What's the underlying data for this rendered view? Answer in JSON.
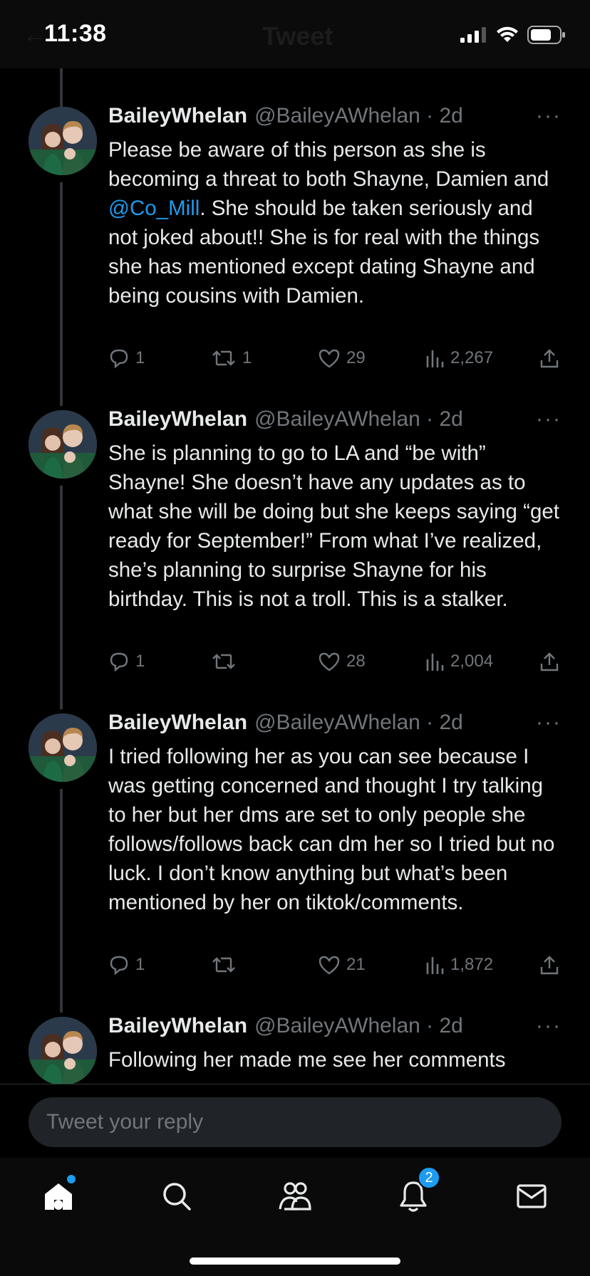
{
  "status_bar": {
    "time": "11:38",
    "ghost_title": "Tweet"
  },
  "thread": [
    {
      "name": "BaileyWhelan",
      "handle": "@BaileyAWhelan · 2d",
      "text_before": "Please be aware of this person as she is becoming a threat to both Shayne, Damien and ",
      "mention": "@Co_Mill",
      "text_after": ". She should be taken seriously and not joked about!! She is for real with the things she has mentioned except dating Shayne and being cousins with Damien.",
      "replies": "1",
      "retweets": "1",
      "likes": "29",
      "views": "2,267"
    },
    {
      "name": "BaileyWhelan",
      "handle": "@BaileyAWhelan · 2d",
      "text": "She is planning to go to LA and “be with” Shayne! She doesn’t have any updates as to what she will be doing but she keeps saying “get ready for September!” From what I’ve realized, she’s planning to surprise Shayne for his birthday. This is not a troll. This is a stalker.",
      "replies": "1",
      "retweets": "",
      "likes": "28",
      "views": "2,004"
    },
    {
      "name": "BaileyWhelan",
      "handle": "@BaileyAWhelan · 2d",
      "text": "I tried following her as you can see because I was getting concerned and thought I try talking to her but her dms are set to only people she follows/follows back can dm her so I tried but no luck. I don’t know anything but what’s been mentioned by her on tiktok/comments.",
      "replies": "1",
      "retweets": "",
      "likes": "21",
      "views": "1,872"
    },
    {
      "name": "BaileyWhelan",
      "handle": "@BaileyAWhelan · 2d",
      "text": "Following her made me see her comments"
    }
  ],
  "reply": {
    "placeholder": "Tweet your reply"
  },
  "nav": {
    "items": [
      "home-icon",
      "search-icon",
      "communities-icon",
      "notifications-icon",
      "messages-icon"
    ],
    "notifications_badge": "2"
  },
  "colors": {
    "accent": "#1d9bf0",
    "muted": "#71767b",
    "text": "#e7e9ea",
    "background": "#000000"
  }
}
